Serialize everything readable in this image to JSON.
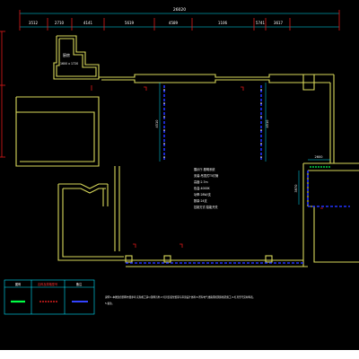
{
  "drawing": {
    "overall_dimension": "26020",
    "top_dimensions": [
      "3512",
      "2710",
      "4141",
      "5619",
      "4589",
      "1106",
      "5741",
      "3617"
    ],
    "side_dimension_label": "1",
    "room_upper_left_label": "厨房",
    "room_upper_left_sublabel": "1600 x 1720",
    "center_note_lines": [
      "展示厅-照明系统",
      "安装:吊顶式T5灯管",
      "高度:2.7m",
      "色温:4000K",
      "功率:28W/支",
      "数量:24支",
      "控制方式:智能开关"
    ],
    "vertical_dim_left": "4510",
    "vertical_dim_right": "4510",
    "right_wall_dim": "3970",
    "right_top_dim": "2600",
    "footer_note_line1": "说明:1.本图仅供照明布置参考,实际施工请以现场为准;2.灯具安装位置需与吊顶设计协调;3.所有电气线路须按国家规范施工;4.灯具型号见材料表。",
    "footer_note_line2": "5.备注。",
    "legend": {
      "headers": [
        "图例",
        "名称及规格型号",
        "备注"
      ],
      "rows": [
        {
          "symbol": "green-bar",
          "color": "#00ff44"
        },
        {
          "symbol": "red-dash",
          "color": "#ff2222"
        },
        {
          "symbol": "blue-bar",
          "color": "#3344ff"
        }
      ]
    }
  },
  "colors": {
    "wall": "#d8d85a",
    "cyan": "#00e5ff",
    "red": "#e01818",
    "blue": "#2233ff",
    "white": "#ffffff",
    "magenta": "#ff00ff",
    "green": "#00ff55"
  }
}
